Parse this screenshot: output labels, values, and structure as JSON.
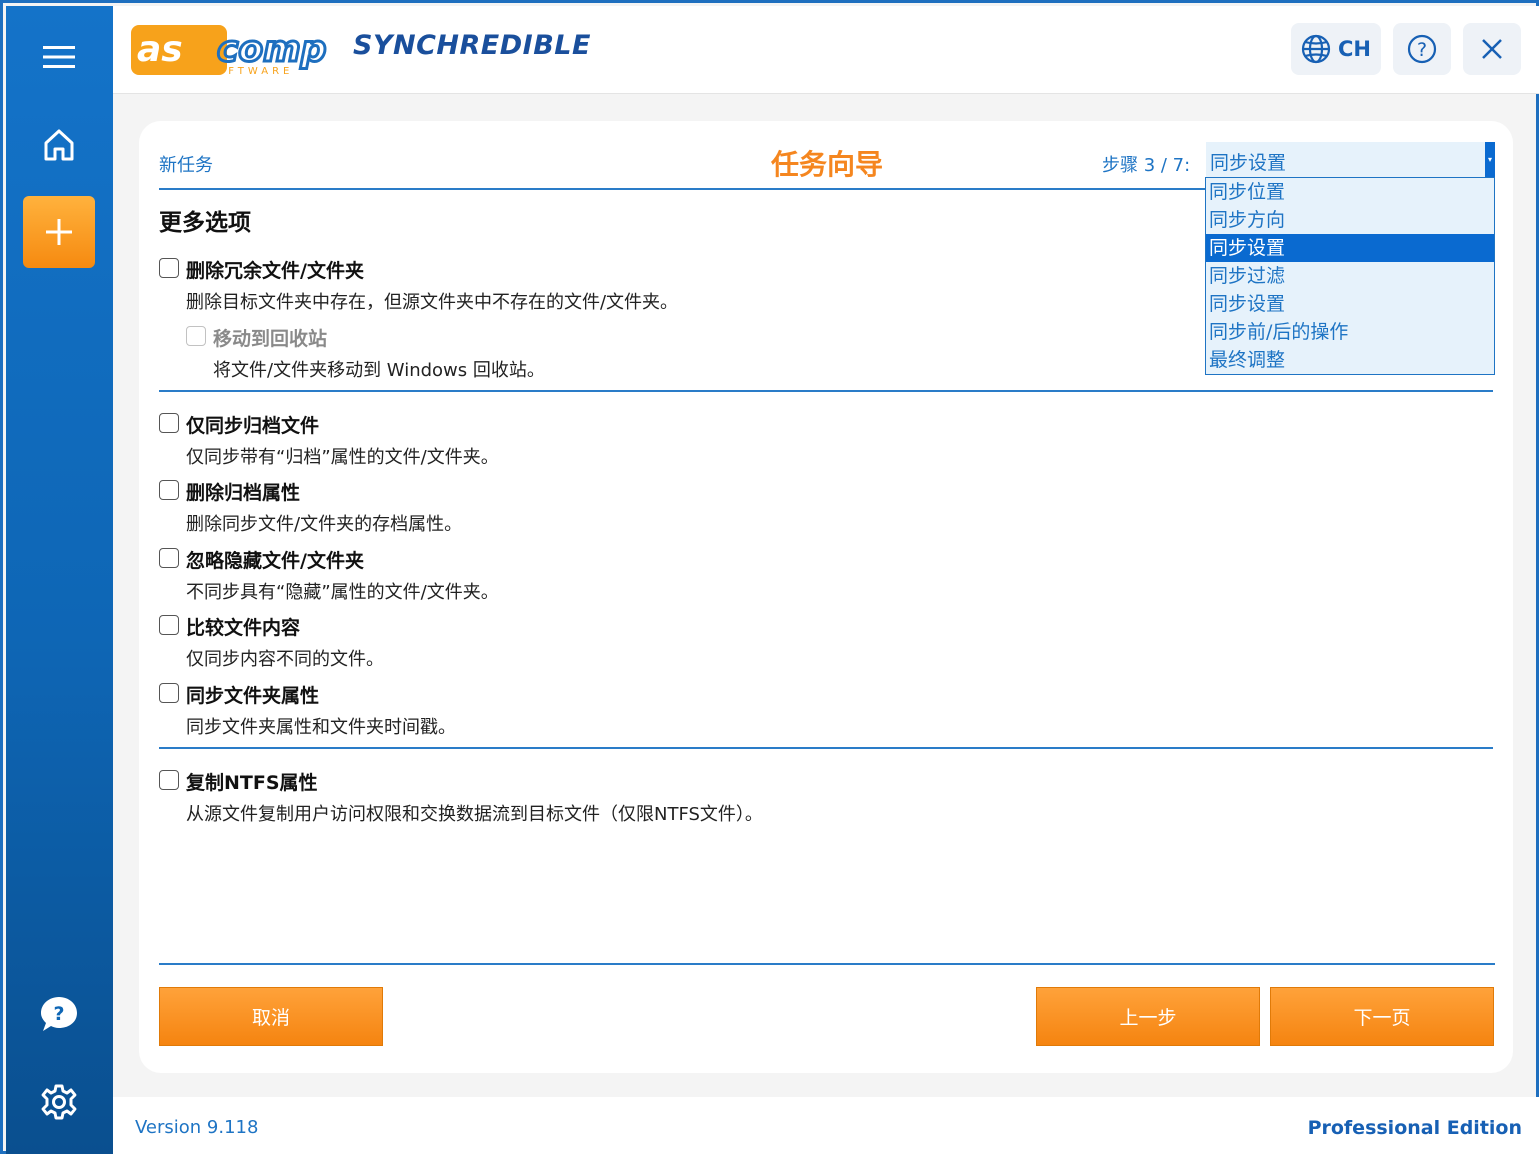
{
  "header": {
    "logo_main": "ascomp",
    "logo_sub": "SOFTWARE",
    "brand": "SYNCHREDIBLE",
    "lang_label": "CH"
  },
  "wizard": {
    "breadcrumb": "新任务",
    "title": "任务向导",
    "step_label": "步骤 3 / 7:",
    "step_selected": "同步设置",
    "step_options": [
      "同步位置",
      "同步方向",
      "同步设置",
      "同步过滤",
      "同步设置",
      "同步前/后的操作",
      "最终调整"
    ],
    "section_title": "更多选项"
  },
  "options": {
    "delete_extra": {
      "label": "删除冗余文件/文件夹",
      "desc": "删除目标文件夹中存在，但源文件夹中不存在的文件/文件夹。",
      "checked": false
    },
    "recycle_bin": {
      "label": "移动到回收站",
      "desc": "将文件/文件夹移动到 Windows 回收站。",
      "checked": false,
      "disabled": true
    },
    "archive_only": {
      "label": "仅同步归档文件",
      "desc": "仅同步带有“归档”属性的文件/文件夹。",
      "checked": false
    },
    "remove_archive": {
      "label": "删除归档属性",
      "desc": "删除同步文件/文件夹的存档属性。",
      "checked": false
    },
    "ignore_hidden": {
      "label": "忽略隐藏文件/文件夹",
      "desc": "不同步具有“隐藏”属性的文件/文件夹。",
      "checked": false
    },
    "compare_content": {
      "label": "比较文件内容",
      "desc": "仅同步内容不同的文件。",
      "checked": false
    },
    "folder_attrs": {
      "label": "同步文件夹属性",
      "desc": "同步文件夹属性和文件夹时间戳。",
      "checked": false
    },
    "ntfs": {
      "label": "复制NTFS属性",
      "desc": "从源文件复制用户访问权限和交换数据流到目标文件（仅限NTFS文件）。",
      "checked": false
    }
  },
  "buttons": {
    "cancel": "取消",
    "back": "上一步",
    "next": "下一页"
  },
  "footer": {
    "version": "Version 9.118",
    "edition": "Professional Edition"
  },
  "colors": {
    "accent_blue": "#1e74c4",
    "accent_orange": "#f5861f",
    "sidebar_blue": "#0e66b5"
  }
}
